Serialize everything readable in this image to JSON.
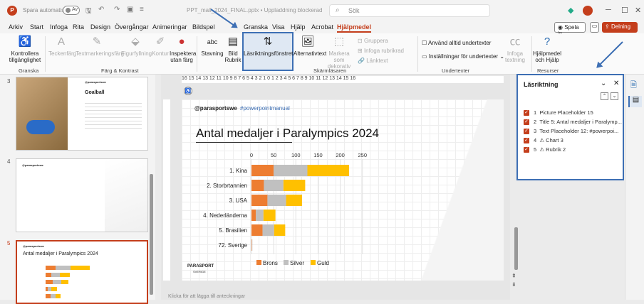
{
  "titlebar": {
    "app_badge": "P",
    "autosave_label": "Spara automatiskt",
    "toggle_text": "Av",
    "filename": "PPT_mall_2024_FINAL.pptx • Uppladdning blockerad",
    "search_placeholder": "Sök"
  },
  "menu": {
    "tabs": [
      "Arkiv",
      "Start",
      "Infoga",
      "Rita",
      "Design",
      "Övergångar",
      "Animeringar",
      "Bildspel",
      "Granska",
      "Visa",
      "Hjälp",
      "Acrobat",
      "Hjälpmedel"
    ],
    "active_tab": "Hjälpmedel",
    "present_label": "Spela in",
    "share_label": "Delning"
  },
  "ribbon": {
    "kontrollera": "Kontrollera tillgänglighet",
    "group_granska": "Granska",
    "teckenfarg": "Teckenfärg",
    "textmarkering": "Textmarkeringsfärg",
    "figurfyllning": "Figurfyllning",
    "kontur": "Kontur",
    "inspektera": "Inspektera utan färg",
    "group_farg": "Färg & Kontrast",
    "stavning": "Stavning",
    "bild_rubrik": "Bild Rubrik",
    "lasriktning_btn": "Läsriktningsfönstret",
    "alternativtext": "Alternativtext",
    "markera_dekorativ": "Markera som dekorativ",
    "gruppera": "Gruppera",
    "infoga_rubrikrad": "Infoga rubrikrad",
    "lanktext": "Länktext",
    "group_skarm": "Skärmläsaren",
    "anvand_undertexter": "Använd alltid undertexter",
    "installningar_undertexter": "Inställningar för undertexter",
    "infoga_textning": "Infoga textning",
    "group_undertexter": "Undertexter",
    "hjalpmedel_btn": "Hjälpmedel och Hjälp",
    "group_resurser": "Resurser",
    "ab_label": "abc"
  },
  "thumbnails": {
    "nums": [
      "3",
      "4",
      "5"
    ],
    "slide3_title": "Goalball",
    "slide5_title": "Antal medaljer i Paralympics 2024",
    "brand": "@parasportswe"
  },
  "ruler": "16 15 14 13 12 11 10 9 8 7 6 5 4 3 2 1 0 1 2 3 4 5 6 7 8 9 10 11 12 13 14 15 16",
  "slide": {
    "handle": "@parasportswe",
    "hashtag": "#powerpointmanual",
    "title": "Antal medaljer i Paralympics 2024",
    "logo": "PARASPORT",
    "logo_sub": "SVERIGE",
    "notes_hint": "Klicka för att lägga till anteckningar"
  },
  "chart_data": {
    "type": "bar",
    "orientation": "horizontal-stacked",
    "title": "",
    "categories": [
      "1. Kina",
      "2. Storbrtannien",
      "3. USA",
      "4. Nederländerna",
      "5. Brasilien",
      "72. Sverige"
    ],
    "series": [
      {
        "name": "Brons",
        "values": [
          50,
          28,
          36,
          10,
          25,
          1
        ]
      },
      {
        "name": "Silver",
        "values": [
          76,
          44,
          42,
          17,
          26,
          1
        ]
      },
      {
        "name": "Guld",
        "values": [
          94,
          49,
          36,
          27,
          25,
          0
        ]
      }
    ],
    "xlim": [
      0,
      250
    ],
    "ticks": [
      0,
      50,
      100,
      150,
      200,
      250
    ],
    "colors": {
      "Brons": "#ed7d31",
      "Silver": "#c0c0c0",
      "Guld": "#ffc000"
    },
    "legend": "bottom"
  },
  "pane": {
    "title": "Läsriktning",
    "items": [
      {
        "num": "1",
        "label": "Picture Placeholder 15"
      },
      {
        "num": "2",
        "label": "Title 5: Antal medaljer i Paralymp..."
      },
      {
        "num": "3",
        "label": "Text Placeholder 12: #powerpoi..."
      },
      {
        "num": "4",
        "label": "⚠ Chart 3"
      },
      {
        "num": "5",
        "label": "⚠ Rubrik 2"
      }
    ]
  },
  "colors": {
    "accent": "#c43e1c",
    "highlight": "#3d6fb4"
  }
}
